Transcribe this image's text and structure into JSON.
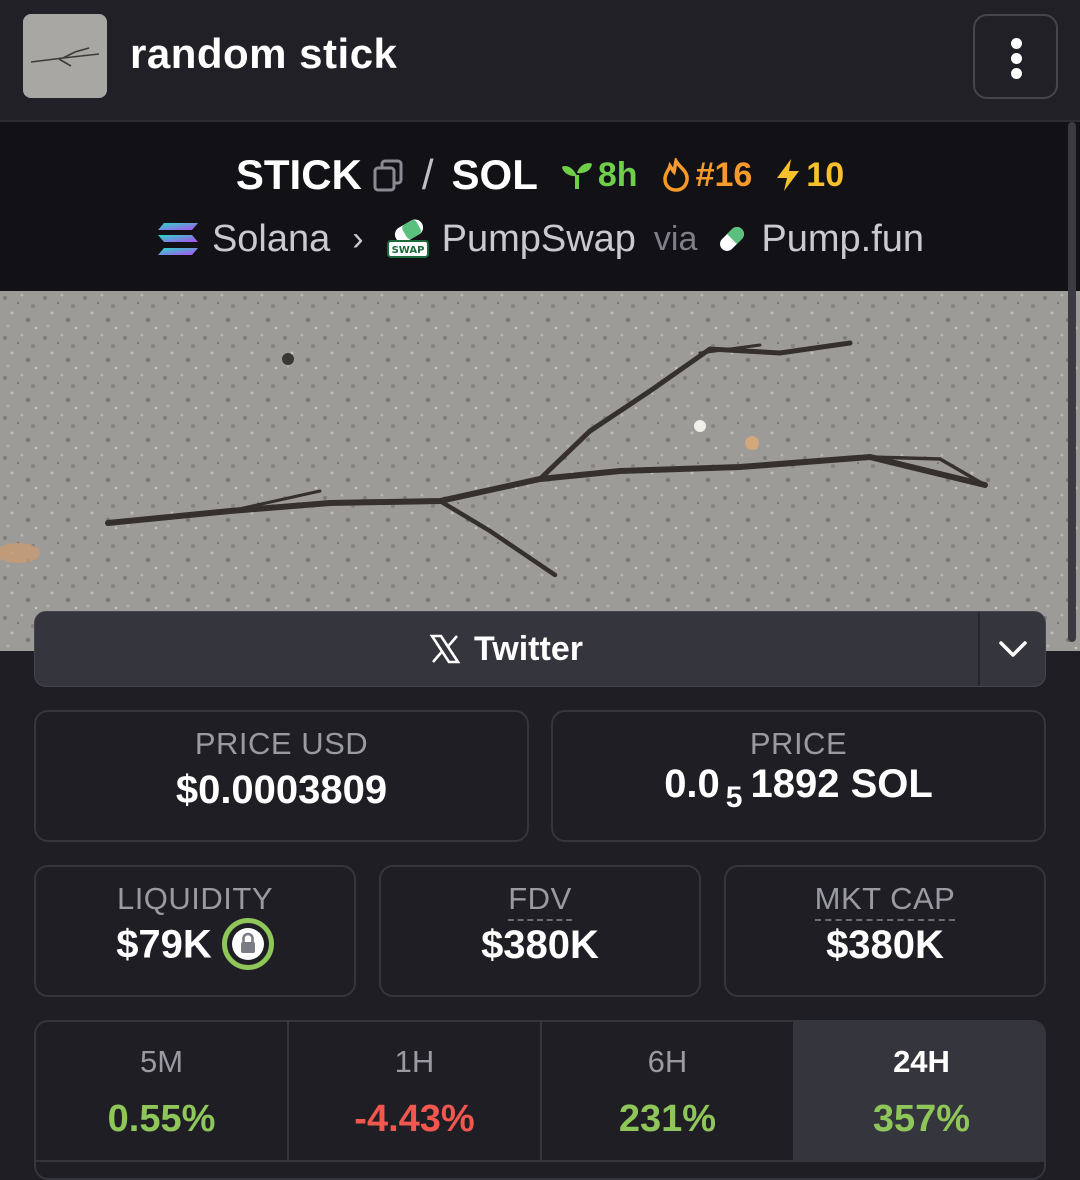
{
  "header": {
    "token_name": "random stick",
    "menu_icon": "kebab-menu-icon"
  },
  "pair": {
    "base": "STICK",
    "separator": "/",
    "quote": "SOL",
    "age": "8h",
    "rank": "#16",
    "boosts": "10"
  },
  "chain": {
    "network": "Solana",
    "dex": "PumpSwap",
    "via_label": "via",
    "launchpad": "Pump.fun"
  },
  "twitter": {
    "label": "Twitter"
  },
  "stats": {
    "price_usd_label": "PRICE USD",
    "price_usd_value": "$0.0003809",
    "price_label": "PRICE",
    "price_prefix": "0.0",
    "price_zeros": "5",
    "price_suffix": "1892 SOL",
    "liquidity_label": "LIQUIDITY",
    "liquidity_value": "$79K",
    "fdv_label": "FDV",
    "fdv_value": "$380K",
    "mktcap_label": "MKT CAP",
    "mktcap_value": "$380K"
  },
  "timeframes": [
    {
      "label": "5M",
      "change": "0.55%",
      "trend": "up"
    },
    {
      "label": "1H",
      "change": "-4.43%",
      "trend": "down"
    },
    {
      "label": "6H",
      "change": "231%",
      "trend": "up"
    },
    {
      "label": "24H",
      "change": "357%",
      "trend": "up",
      "active": true
    }
  ],
  "colors": {
    "positive": "#8ec659",
    "negative": "#f0574f",
    "age_badge": "#6fcf4b",
    "rank_badge": "#f79a2a",
    "boost_badge": "#f6c12c"
  }
}
